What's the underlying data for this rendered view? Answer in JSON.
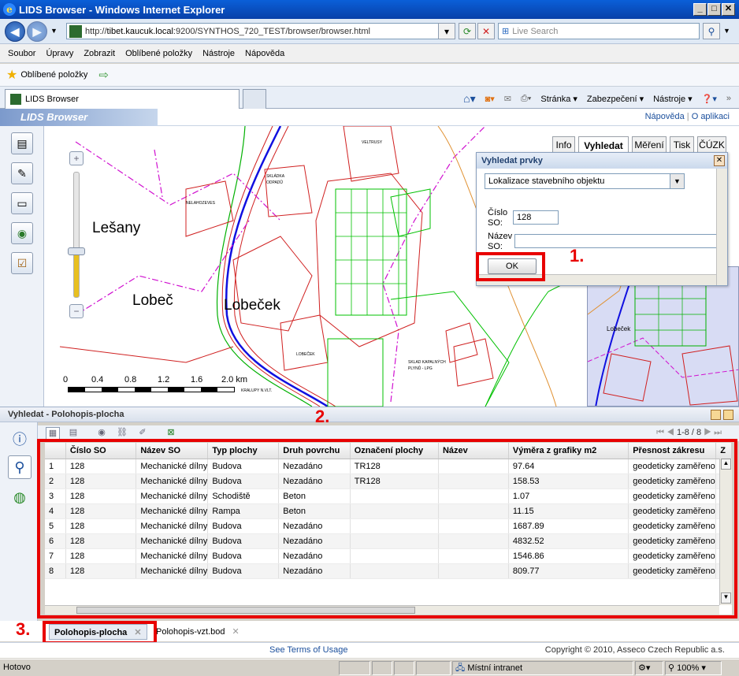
{
  "window": {
    "title": "LIDS Browser - Windows Internet Explorer"
  },
  "address": {
    "scheme": "http://",
    "host": "tibet.kaucuk.local",
    "path": ":9200/SYNTHOS_720_TEST/browser/browser.html"
  },
  "search": {
    "placeholder": "Live Search"
  },
  "menu": [
    "Soubor",
    "Úpravy",
    "Zobrazit",
    "Oblíbené položky",
    "Nástroje",
    "Nápověda"
  ],
  "favorites": {
    "label": "Oblíbené položky"
  },
  "tabs": [
    {
      "label": "LIDS Browser"
    }
  ],
  "commands": {
    "page": "Stránka ▾",
    "security": "Zabezpečení ▾",
    "tools": "Nástroje ▾"
  },
  "app": {
    "title": "LIDS Browser",
    "help": "Nápověda",
    "about": "O aplikaci"
  },
  "map": {
    "places": [
      "Lešany",
      "Lobeč",
      "Lobeček"
    ],
    "scale": [
      "0",
      "0.4",
      "0.8",
      "1.2",
      "1.6",
      "2.0 km"
    ],
    "tabs": [
      "Info",
      "Vyhledat",
      "Měření",
      "Tisk",
      "ČÚZK"
    ],
    "active_tab": "Vyhledat",
    "overview_label": "Lobeček",
    "labels": {
      "veltrusy": "VELTRUSY",
      "nelahozeves": "NELAHOZEVES",
      "skladka": "SKLÁDKA ODPADŮ",
      "lobecek_small": "LOBEČEK",
      "sklad": "SKLAD KAPALNÝCH PLYNŮ - LPG",
      "kralupy": "KRALUPY N.VLT."
    }
  },
  "search_dialog": {
    "title": "Vyhledat prvky",
    "select_value": "Lokalizace stavebního objektu",
    "field1_label": "Číslo SO:",
    "field1_value": "128",
    "field2_label": "Název SO:",
    "field2_value": "",
    "ok_label": "OK"
  },
  "annotations": [
    "1.",
    "2.",
    "3."
  ],
  "results": {
    "title": "Vyhledat - Polohopis-plocha",
    "pager": "1-8 / 8",
    "columns": [
      "",
      "Číslo SO",
      "Název SO",
      "Typ plochy",
      "Druh povrchu",
      "Označení plochy",
      "Název",
      "Výměra z grafiky m2",
      "Přesnost zákresu",
      "Z"
    ],
    "rows": [
      [
        "1",
        "128",
        "Mechanické dílny",
        "Budova",
        "Nezadáno",
        "TR128",
        "",
        "97.64",
        "geodeticky zaměřeno"
      ],
      [
        "2",
        "128",
        "Mechanické dílny",
        "Budova",
        "Nezadáno",
        "TR128",
        "",
        "158.53",
        "geodeticky zaměřeno"
      ],
      [
        "3",
        "128",
        "Mechanické dílny",
        "Schodiště",
        "Beton",
        "",
        "",
        "1.07",
        "geodeticky zaměřeno"
      ],
      [
        "4",
        "128",
        "Mechanické dílny",
        "Rampa",
        "Beton",
        "",
        "",
        "11.15",
        "geodeticky zaměřeno"
      ],
      [
        "5",
        "128",
        "Mechanické dílny",
        "Budova",
        "Nezadáno",
        "",
        "",
        "1687.89",
        "geodeticky zaměřeno"
      ],
      [
        "6",
        "128",
        "Mechanické dílny",
        "Budova",
        "Nezadáno",
        "",
        "",
        "4832.52",
        "geodeticky zaměřeno"
      ],
      [
        "7",
        "128",
        "Mechanické dílny",
        "Budova",
        "Nezadáno",
        "",
        "",
        "1546.86",
        "geodeticky zaměřeno"
      ],
      [
        "8",
        "128",
        "Mechanické dílny",
        "Budova",
        "Nezadáno",
        "",
        "",
        "809.77",
        "geodeticky zaměřeno"
      ]
    ]
  },
  "bottom_tabs": [
    "Polohopis-plocha",
    "Polohopis-vzt.bod"
  ],
  "footer": {
    "terms": "See Terms of Usage",
    "copyright": "Copyright © 2010, Asseco Czech Republic a.s."
  },
  "status": {
    "text": "Hotovo",
    "zone": "Místní intranet",
    "zoom": "100%"
  }
}
